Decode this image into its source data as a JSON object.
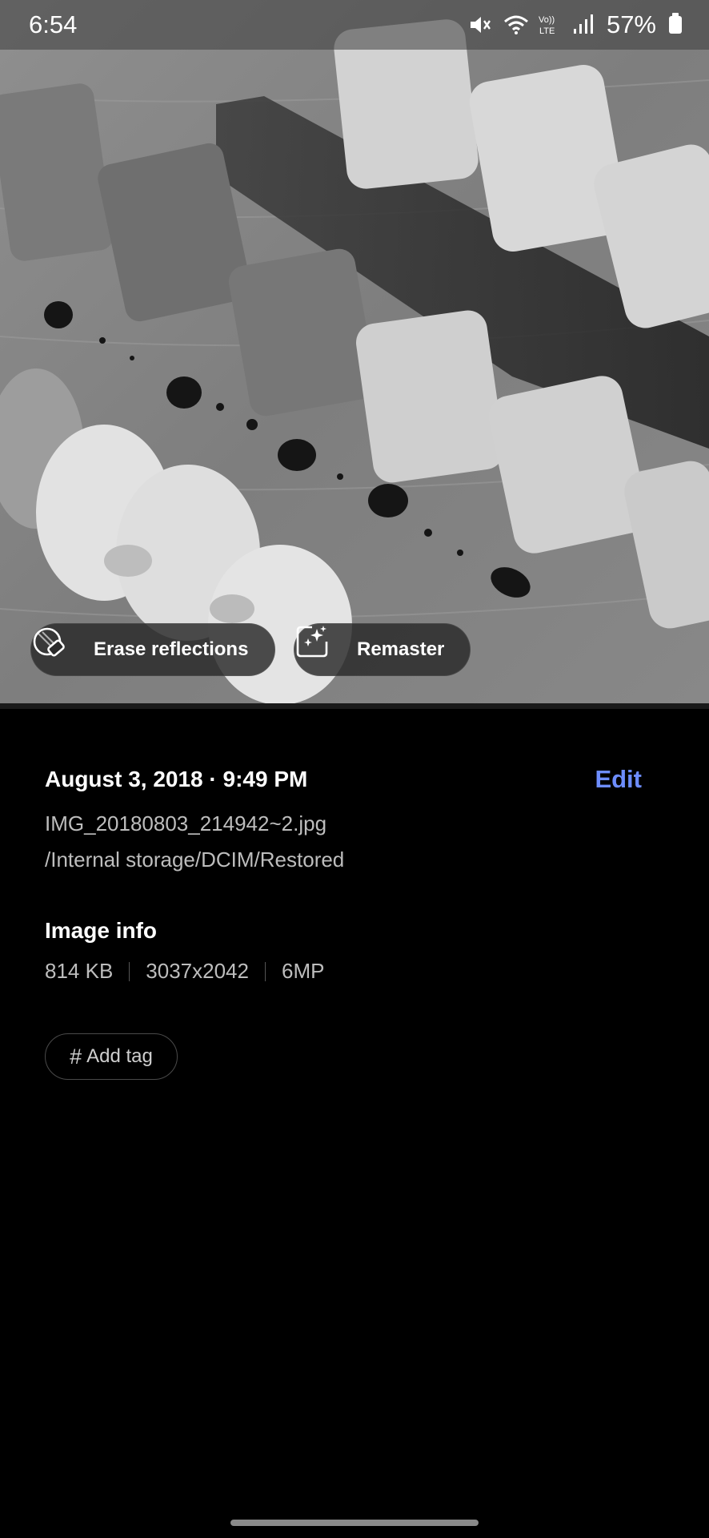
{
  "status_bar": {
    "time": "6:54",
    "battery_percent": "57%",
    "icons": [
      "mute-icon",
      "wifi-icon",
      "volte-icon",
      "signal-icon",
      "battery-icon"
    ],
    "network_label": "Vo)) LTE"
  },
  "photo": {
    "subject": "sushi-rolls-photo",
    "actions": {
      "erase_label": "Erase reflections",
      "remaster_label": "Remaster"
    }
  },
  "details": {
    "date_time": "August 3, 2018 · 9:49 PM",
    "edit_label": "Edit",
    "filename": "IMG_20180803_214942~2.jpg",
    "path": "/Internal storage/DCIM/Restored"
  },
  "image_info": {
    "title": "Image info",
    "size": "814 KB",
    "resolution": "3037x2042",
    "megapixels": "6MP"
  },
  "tags": {
    "hash": "#",
    "add_label": "Add tag"
  },
  "colors": {
    "accent": "#6d8dff",
    "background": "#000000",
    "secondary_text": "#bdbdbd"
  }
}
